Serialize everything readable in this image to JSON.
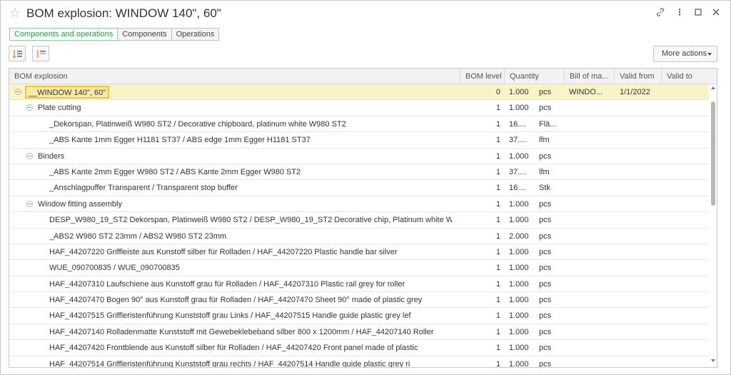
{
  "window": {
    "title": "BOM explosion: WINDOW 140\", 60\"",
    "icons": [
      "star-icon",
      "link-icon",
      "more-vertical-icon",
      "maximize-icon",
      "close-icon"
    ]
  },
  "tabs": [
    {
      "label": "Components and operations",
      "active": true
    },
    {
      "label": "Components",
      "active": false
    },
    {
      "label": "Operations",
      "active": false
    }
  ],
  "toolbar": {
    "more_actions_label": "More actions"
  },
  "grid": {
    "columns": [
      "BOM explosion",
      "BOM level",
      "Quantity",
      "Bill of ma...",
      "Valid from",
      "Valid to"
    ],
    "rows": [
      {
        "name": "__WINDOW 140\", 60\"",
        "level": "0",
        "qty": "1.000",
        "unit": "pcs",
        "bom": "WINDO...",
        "from": "1/1/2022",
        "to": ""
      },
      {
        "name": "Plate cutting",
        "level": "1",
        "qty": "1.000",
        "unit": "pcs",
        "bom": "",
        "from": "",
        "to": ""
      },
      {
        "name": "_Dekorspan, Platinweiß W980 ST2 / Decorative chipboard, platinum white W980 ST2",
        "level": "1",
        "qty": "16....",
        "unit": "Flä...",
        "bom": "",
        "from": "",
        "to": ""
      },
      {
        "name": "_ABS Kante 1mm Egger H1181 ST37 / ABS edge 1mm Egger H1181 ST37",
        "level": "1",
        "qty": "37....",
        "unit": "lfm",
        "bom": "",
        "from": "",
        "to": ""
      },
      {
        "name": "Binders",
        "level": "1",
        "qty": "1.000",
        "unit": "pcs",
        "bom": "",
        "from": "",
        "to": ""
      },
      {
        "name": "_ABS Kante 2mm Egger W980 ST2 / ABS Kante 2mm Egger W980 ST2",
        "level": "1",
        "qty": "37....",
        "unit": "lfm",
        "bom": "",
        "from": "",
        "to": ""
      },
      {
        "name": "_Anschlagpuffer Transparent  / Transparent stop buffer",
        "level": "1",
        "qty": "16....",
        "unit": "Stk",
        "bom": "",
        "from": "",
        "to": ""
      },
      {
        "name": "Window fitting assembly",
        "level": "1",
        "qty": "1.000",
        "unit": "pcs",
        "bom": "",
        "from": "",
        "to": ""
      },
      {
        "name": "DESP_W980_19_ST2 Dekorspan, Platinweiß W980 ST2 / DESP_W980_19_ST2 Decorative chip, Platinum white W",
        "level": "1",
        "qty": "1.000",
        "unit": "pcs",
        "bom": "",
        "from": "",
        "to": ""
      },
      {
        "name": "_ABS2 W980 ST2 23mm / ABS2 W980 ST2 23mm",
        "level": "1",
        "qty": "2.000",
        "unit": "pcs",
        "bom": "",
        "from": "",
        "to": ""
      },
      {
        "name": "HAF_44207220 Griffleiste aus Kunstoff silber für Rolladen / HAF_44207220 Plastic handle bar silver",
        "level": "1",
        "qty": "1.000",
        "unit": "pcs",
        "bom": "",
        "from": "",
        "to": ""
      },
      {
        "name": "WUE_090700835 / WUE_090700835",
        "level": "1",
        "qty": "1.000",
        "unit": "pcs",
        "bom": "",
        "from": "",
        "to": ""
      },
      {
        "name": "HAF_44207310 Laufschiene aus Kunstoff grau für Rolladen / HAF_44207310 Plastic rail grey for roller",
        "level": "1",
        "qty": "1.000",
        "unit": "pcs",
        "bom": "",
        "from": "",
        "to": ""
      },
      {
        "name": "HAF_44207470 Bogen 90° aus Kunstoff grau für Rolladen / HAF_44207470 Sheet 90° made of plastic grey",
        "level": "1",
        "qty": "1.000",
        "unit": "pcs",
        "bom": "",
        "from": "",
        "to": ""
      },
      {
        "name": "HAF_44207515 Griffleristenführung Kunststoff grau Links / HAF_44207515 Handle guide plastic grey lef",
        "level": "1",
        "qty": "1.000",
        "unit": "pcs",
        "bom": "",
        "from": "",
        "to": ""
      },
      {
        "name": "HAF_44207140 Rolladenmatte Kunststoff mit Gewebeklebeband silber 800 x 1200mm / HAF_44207140 Roller",
        "level": "1",
        "qty": "1.000",
        "unit": "pcs",
        "bom": "",
        "from": "",
        "to": ""
      },
      {
        "name": "HAF_44207420 Frontblende aus Kunstoff silber für Rolladen / HAF_44207420 Front panel made of plastic",
        "level": "1",
        "qty": "1.000",
        "unit": "pcs",
        "bom": "",
        "from": "",
        "to": ""
      },
      {
        "name": "HAF_44207514 Griffleristenführung Kunststoff grau rechts / HAF_44207514 Handle guide plastic grey ri",
        "level": "1",
        "qty": "1.000",
        "unit": "pcs",
        "bom": "",
        "from": "",
        "to": ""
      }
    ]
  },
  "colors": {
    "active_tab": "#1f9c48",
    "selected_row": "#faf3c6",
    "selected_box_border": "#f0c341"
  }
}
